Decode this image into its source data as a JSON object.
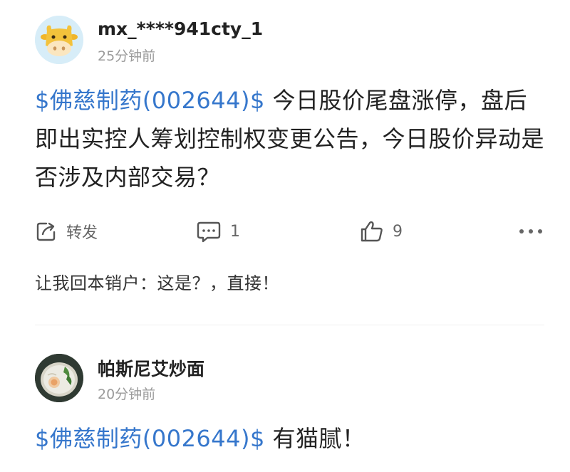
{
  "posts": [
    {
      "username": "mx_****941cty_1",
      "time": "25分钟前",
      "stock_tag": "$佛慈制药(002644)$",
      "text": " 今日股价尾盘涨停，盘后即出实控人筹划控制权变更公告，今日股价异动是否涉及内部交易？",
      "actions": {
        "repost_label": "转发",
        "comment_count": "1",
        "like_count": "9"
      },
      "reply": "让我回本销户：这是？，直接！",
      "avatar_icon": "cow-avatar-icon"
    },
    {
      "username": "帕斯尼艾炒面",
      "time": "20分钟前",
      "stock_tag": "$佛慈制药(002644)$",
      "text": " 有猫腻！",
      "avatar_icon": "food-photo-avatar"
    }
  ],
  "colors": {
    "link": "#3677cc",
    "muted": "#9a9a9a",
    "text": "#222222"
  }
}
